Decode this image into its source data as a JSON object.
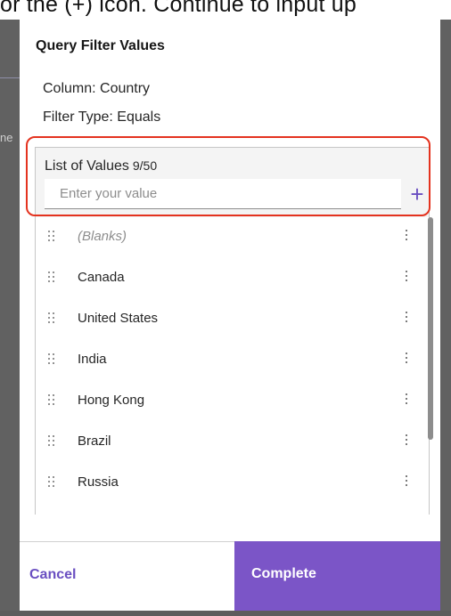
{
  "instruction_fragment": "or the (+) icon. Continue to input up",
  "backdrop": {
    "left_fragment": "ne"
  },
  "dialog": {
    "title": "Query Filter Values",
    "column_line": "Column: Country",
    "filter_type_line": "Filter Type: Equals",
    "list": {
      "label": "List of Values",
      "count": "9/50",
      "input_placeholder": "Enter your value",
      "input_value": "",
      "add_icon": "plus-icon",
      "items": [
        {
          "label": "(Blanks)",
          "blank": true
        },
        {
          "label": "Canada"
        },
        {
          "label": "United States"
        },
        {
          "label": "India"
        },
        {
          "label": "Hong Kong"
        },
        {
          "label": "Brazil"
        },
        {
          "label": "Russia"
        }
      ]
    },
    "buttons": {
      "cancel": "Cancel",
      "complete": "Complete"
    }
  },
  "colors": {
    "accent": "#7b55c7",
    "accent_text": "#6a4fc1",
    "highlight": "#e4331f",
    "backdrop": "#616161"
  }
}
